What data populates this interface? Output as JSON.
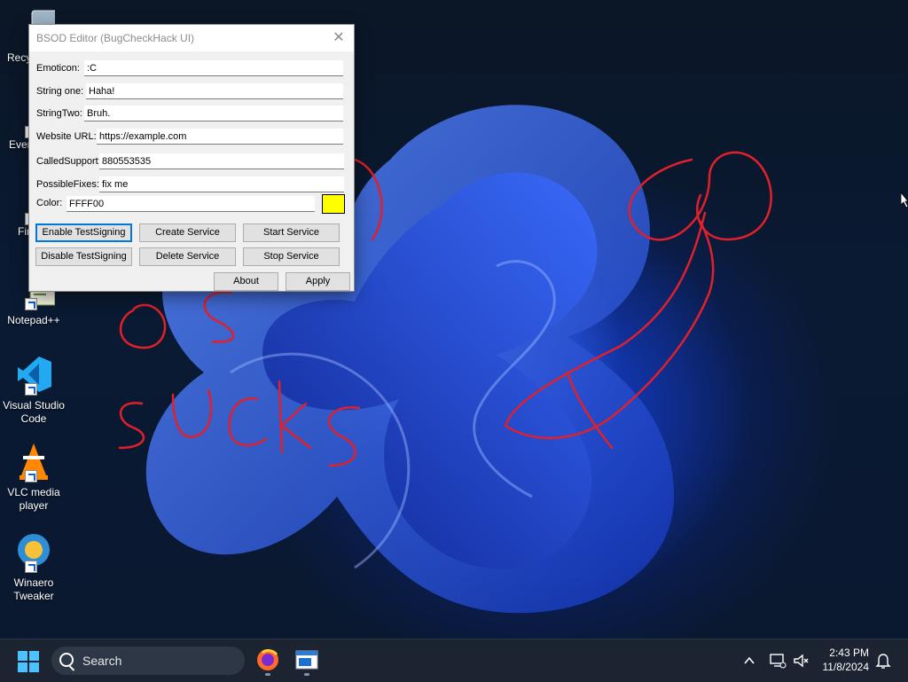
{
  "desktop": {
    "icons": [
      {
        "label": "Recy",
        "icon": "recycle-bin-icon"
      },
      {
        "label": "Ever",
        "icon": "everything-icon"
      },
      {
        "label": "Fir",
        "icon": "firefox-icon"
      },
      {
        "label": "Notepad++",
        "icon": "notepadpp-icon"
      },
      {
        "label": "Visual Studio Code",
        "icon": "vscode-icon"
      },
      {
        "label": "VLC media player",
        "icon": "vlc-icon"
      },
      {
        "label": "Winaero Tweaker",
        "icon": "winaero-icon"
      }
    ],
    "scribbles": [
      "O S",
      "SUCKS"
    ]
  },
  "dialog": {
    "title": "BSOD Editor (BugCheckHack UI)",
    "close_glyph": "✕",
    "fields": {
      "emoticon": {
        "label": "Emoticon:",
        "value": ":C"
      },
      "string_one": {
        "label": "String one:",
        "value": "Haha!"
      },
      "string_two": {
        "label": "StringTwo:",
        "value": "Bruh."
      },
      "website_url": {
        "label": "Website URL:",
        "value": "https://example.com"
      },
      "called_support": {
        "label": "CalledSupport:",
        "value": "880553535"
      },
      "possible_fixes": {
        "label": "PossibleFixes:",
        "value": "fix me"
      },
      "color": {
        "label": "Color:",
        "value": "FFFF00"
      }
    },
    "swatch_color": "#FFFF00",
    "buttons": {
      "enable_testsigning": "Enable TestSigning",
      "create_service": "Create Service",
      "start_service": "Start Service",
      "disable_testsigning": "Disable TestSigning",
      "delete_service": "Delete Service",
      "stop_service": "Stop Service",
      "about": "About",
      "apply": "Apply"
    }
  },
  "taskbar": {
    "search_placeholder": "Search",
    "time": "2:43 PM",
    "date": "11/8/2024",
    "pinned": [
      "firefox-icon",
      "bsod-editor-app-icon"
    ],
    "tray_icons": [
      "chevron-up-icon",
      "network-icon",
      "volume-muted-icon",
      "notification-bell-icon"
    ]
  },
  "colors": {
    "accent": "#0078d7",
    "scribble": "#e0202a",
    "taskbar": "#1c2431"
  }
}
